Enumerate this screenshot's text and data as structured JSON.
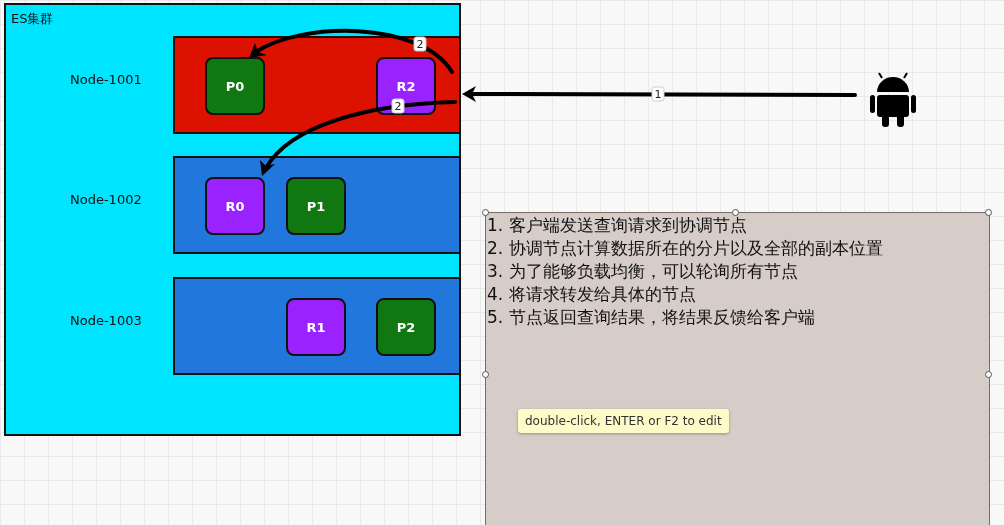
{
  "cluster": {
    "title": "ES集群",
    "nodes": [
      {
        "name": "Node-1001",
        "color": "#dd1100",
        "shards": [
          {
            "label": "P0",
            "kind": "primary"
          },
          {
            "label": "R2",
            "kind": "replica"
          }
        ]
      },
      {
        "name": "Node-1002",
        "color": "#2277dd",
        "shards": [
          {
            "label": "R0",
            "kind": "replica"
          },
          {
            "label": "P1",
            "kind": "primary"
          }
        ]
      },
      {
        "name": "Node-1003",
        "color": "#2277dd",
        "shards": [
          {
            "label": "R1",
            "kind": "replica"
          },
          {
            "label": "P2",
            "kind": "primary"
          }
        ]
      }
    ]
  },
  "edges": [
    {
      "label": "1"
    },
    {
      "label": "2"
    },
    {
      "label": "2"
    }
  ],
  "note": {
    "selected": true,
    "lines": [
      "1. 客户端发送查询请求到协调节点",
      "2. 协调节点计算数据所在的分片以及全部的副本位置",
      "3. 为了能够负载均衡，可以轮询所有节点",
      "4. 将请求转发给具体的节点",
      "5. 节点返回查询结果，将结果反馈给客户端"
    ]
  },
  "tooltip": "double-click, ENTER or F2 to edit"
}
